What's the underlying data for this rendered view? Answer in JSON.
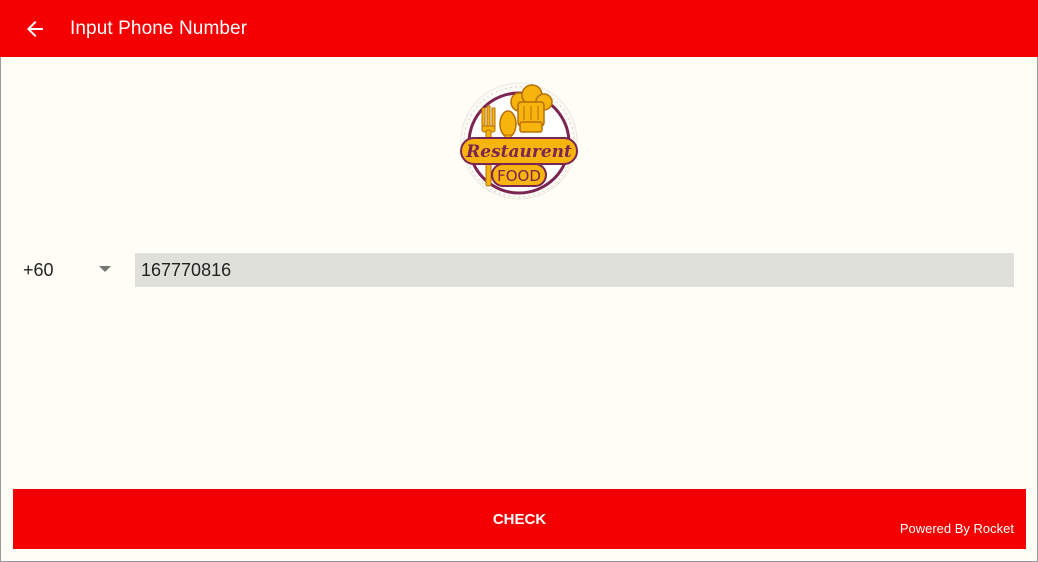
{
  "appbar": {
    "title": "Input Phone Number",
    "back_icon": "arrow-left-icon",
    "background_color": "#F50000"
  },
  "logo": {
    "line1": "Restaurent",
    "line2": "FOOD"
  },
  "phone": {
    "country_code": "+60",
    "caret_icon": "caret-down-icon",
    "number": "167770816"
  },
  "actions": {
    "check_label": "CHECK",
    "powered_by": "Powered By Rocket"
  }
}
